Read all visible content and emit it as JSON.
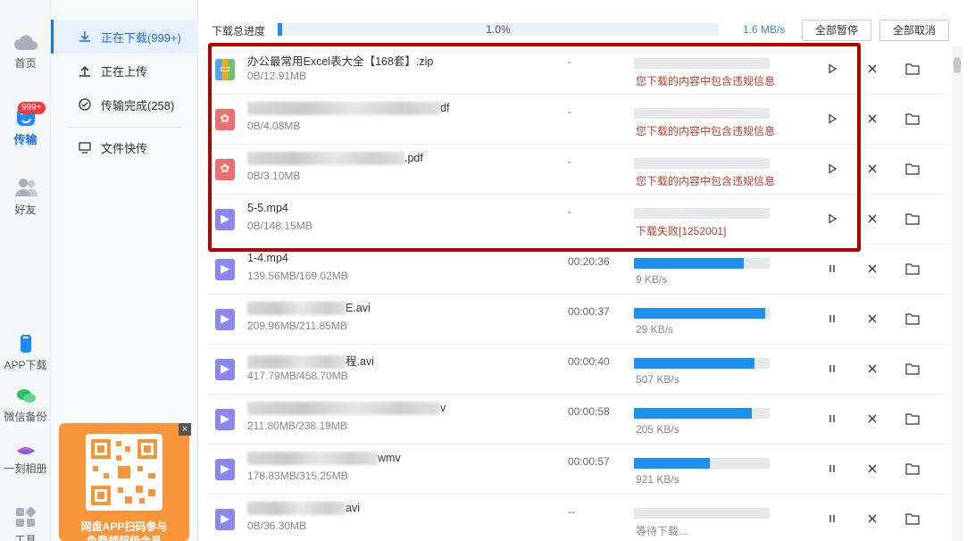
{
  "rail": {
    "items": [
      {
        "label": "首页",
        "icon": "cloud-icon"
      },
      {
        "label": "传输",
        "icon": "transfer-icon",
        "badge": "999+"
      },
      {
        "label": "好友",
        "icon": "friends-icon"
      },
      {
        "label": "APP下载",
        "icon": "phone-icon"
      },
      {
        "label": "微信备份",
        "icon": "wechat-icon"
      },
      {
        "label": "一刻相册",
        "icon": "album-icon"
      },
      {
        "label": "工具",
        "icon": "tools-icon"
      }
    ]
  },
  "sidebar": {
    "items": [
      {
        "label": "正在下载(999+)",
        "icon": "download-icon"
      },
      {
        "label": "正在上传",
        "icon": "upload-icon"
      },
      {
        "label": "传输完成(258)",
        "icon": "check-circle-icon"
      },
      {
        "label": "文件快传",
        "icon": "monitor-icon"
      }
    ]
  },
  "promo": {
    "close": "×",
    "line1": "网盘APP扫码参与",
    "line2": "免费领超级会员"
  },
  "topbar": {
    "label": "下载总进度",
    "percent_text": "1.0%",
    "progress": 0.01,
    "speed": "1.6 MB/s",
    "pause_all": "全部暂停",
    "cancel_all": "全部取消"
  },
  "downloads": [
    {
      "name": "办公最常用Excel表大全【168套】.zip",
      "size": "0B/12.91MB",
      "eta": "-",
      "progress": 0,
      "status": "您下载的内容中包含违规信息",
      "type": "zip",
      "error": true,
      "action": "play"
    },
    {
      "name": "df",
      "size": "0B/4.08MB",
      "eta": "-",
      "progress": 0,
      "status": "您下载的内容中包含违规信息",
      "type": "pdf",
      "error": true,
      "action": "play"
    },
    {
      "name": ".pdf",
      "size": "0B/3.10MB",
      "eta": "-",
      "progress": 0,
      "status": "您下载的内容中包含违规信息",
      "type": "pdf",
      "error": true,
      "action": "play"
    },
    {
      "name": "5-5.mp4",
      "size": "0B/148.15MB",
      "eta": "-",
      "progress": 0,
      "status": "下载失败[1252001]",
      "type": "video",
      "error": true,
      "action": "play"
    },
    {
      "name": "1-4.mp4",
      "size": "139.56MB/169.02MB",
      "eta": "00:20:36",
      "progress": 0.81,
      "status": "9 KB/s",
      "type": "video",
      "error": false,
      "action": "pause"
    },
    {
      "name": "E.avi",
      "size": "209.96MB/211.85MB",
      "eta": "00:00:37",
      "progress": 0.97,
      "status": "29 KB/s",
      "type": "video",
      "error": false,
      "action": "pause"
    },
    {
      "name": "程.avi",
      "size": "417.79MB/458.70MB",
      "eta": "00:00:40",
      "progress": 0.89,
      "status": "507 KB/s",
      "type": "video",
      "error": false,
      "action": "pause"
    },
    {
      "name": "v",
      "size": "211.80MB/238.19MB",
      "eta": "00:00:58",
      "progress": 0.87,
      "status": "205 KB/s",
      "type": "video",
      "error": false,
      "action": "pause"
    },
    {
      "name": "wmv",
      "size": "178.83MB/315.25MB",
      "eta": "00:00:57",
      "progress": 0.56,
      "status": "921 KB/s",
      "type": "video",
      "error": false,
      "action": "pause"
    },
    {
      "name": "avi",
      "size": "0B/36.30MB",
      "eta": "--",
      "progress": 0,
      "status": "等待下载...",
      "type": "video",
      "error": false,
      "action": "pause"
    }
  ]
}
